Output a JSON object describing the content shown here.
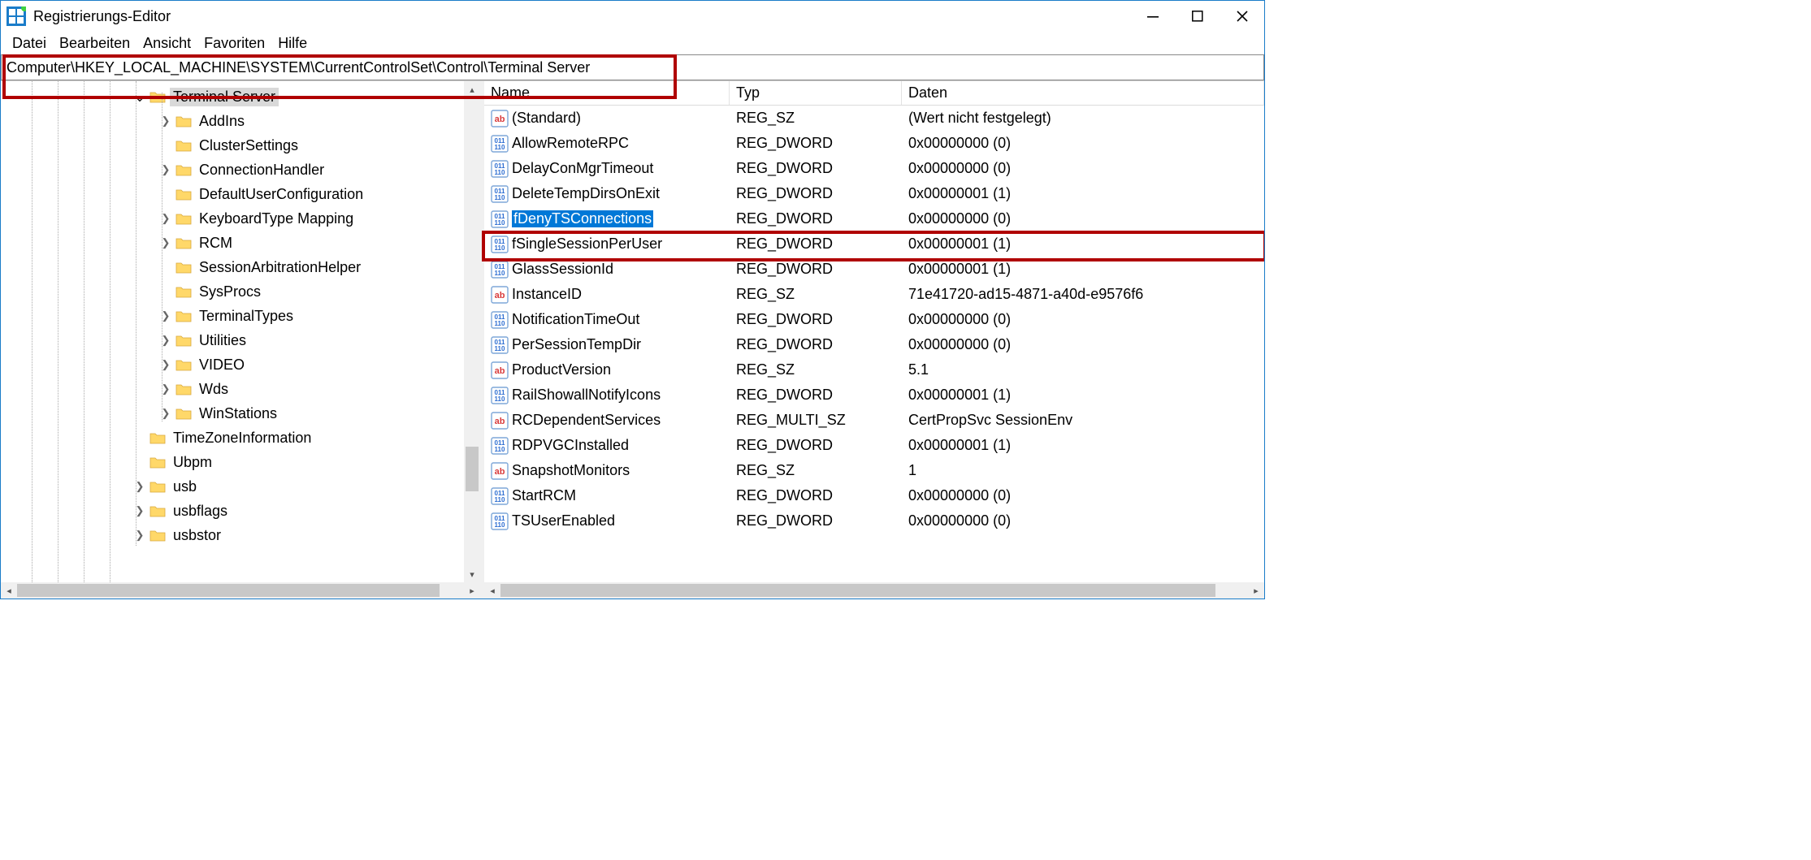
{
  "window": {
    "title": "Registrierungs-Editor"
  },
  "menu": {
    "file": "Datei",
    "edit": "Bearbeiten",
    "view": "Ansicht",
    "favorites": "Favoriten",
    "help": "Hilfe"
  },
  "address": "Computer\\HKEY_LOCAL_MACHINE\\SYSTEM\\CurrentControlSet\\Control\\Terminal Server",
  "tree": [
    {
      "indent": 160,
      "expander": "open",
      "label": "Terminal Server",
      "selected": true
    },
    {
      "indent": 192,
      "expander": "closed",
      "label": "AddIns"
    },
    {
      "indent": 192,
      "expander": "none",
      "label": "ClusterSettings"
    },
    {
      "indent": 192,
      "expander": "closed",
      "label": "ConnectionHandler"
    },
    {
      "indent": 192,
      "expander": "none",
      "label": "DefaultUserConfiguration"
    },
    {
      "indent": 192,
      "expander": "closed",
      "label": "KeyboardType Mapping"
    },
    {
      "indent": 192,
      "expander": "closed",
      "label": "RCM"
    },
    {
      "indent": 192,
      "expander": "none",
      "label": "SessionArbitrationHelper"
    },
    {
      "indent": 192,
      "expander": "none",
      "label": "SysProcs"
    },
    {
      "indent": 192,
      "expander": "closed",
      "label": "TerminalTypes"
    },
    {
      "indent": 192,
      "expander": "closed",
      "label": "Utilities"
    },
    {
      "indent": 192,
      "expander": "closed",
      "label": "VIDEO"
    },
    {
      "indent": 192,
      "expander": "closed",
      "label": "Wds"
    },
    {
      "indent": 192,
      "expander": "closed",
      "label": "WinStations"
    },
    {
      "indent": 160,
      "expander": "none",
      "label": "TimeZoneInformation"
    },
    {
      "indent": 160,
      "expander": "none",
      "label": "Ubpm"
    },
    {
      "indent": 160,
      "expander": "closed",
      "label": "usb"
    },
    {
      "indent": 160,
      "expander": "closed",
      "label": "usbflags"
    },
    {
      "indent": 160,
      "expander": "closed",
      "label": "usbstor"
    }
  ],
  "columns": {
    "name": "Name",
    "type": "Typ",
    "data": "Daten"
  },
  "values": [
    {
      "icon": "sz",
      "name": "(Standard)",
      "type": "REG_SZ",
      "data": "(Wert nicht festgelegt)"
    },
    {
      "icon": "bin",
      "name": "AllowRemoteRPC",
      "type": "REG_DWORD",
      "data": "0x00000000 (0)"
    },
    {
      "icon": "bin",
      "name": "DelayConMgrTimeout",
      "type": "REG_DWORD",
      "data": "0x00000000 (0)"
    },
    {
      "icon": "bin",
      "name": "DeleteTempDirsOnExit",
      "type": "REG_DWORD",
      "data": "0x00000001 (1)"
    },
    {
      "icon": "bin",
      "name": "fDenyTSConnections",
      "type": "REG_DWORD",
      "data": "0x00000000 (0)",
      "selected": true
    },
    {
      "icon": "bin",
      "name": "fSingleSessionPerUser",
      "type": "REG_DWORD",
      "data": "0x00000001 (1)"
    },
    {
      "icon": "bin",
      "name": "GlassSessionId",
      "type": "REG_DWORD",
      "data": "0x00000001 (1)"
    },
    {
      "icon": "sz",
      "name": "InstanceID",
      "type": "REG_SZ",
      "data": "71e41720-ad15-4871-a40d-e9576f6"
    },
    {
      "icon": "bin",
      "name": "NotificationTimeOut",
      "type": "REG_DWORD",
      "data": "0x00000000 (0)"
    },
    {
      "icon": "bin",
      "name": "PerSessionTempDir",
      "type": "REG_DWORD",
      "data": "0x00000000 (0)"
    },
    {
      "icon": "sz",
      "name": "ProductVersion",
      "type": "REG_SZ",
      "data": "5.1"
    },
    {
      "icon": "bin",
      "name": "RailShowallNotifyIcons",
      "type": "REG_DWORD",
      "data": "0x00000001 (1)"
    },
    {
      "icon": "sz",
      "name": "RCDependentServices",
      "type": "REG_MULTI_SZ",
      "data": "CertPropSvc SessionEnv"
    },
    {
      "icon": "bin",
      "name": "RDPVGCInstalled",
      "type": "REG_DWORD",
      "data": "0x00000001 (1)"
    },
    {
      "icon": "sz",
      "name": "SnapshotMonitors",
      "type": "REG_SZ",
      "data": "1"
    },
    {
      "icon": "bin",
      "name": "StartRCM",
      "type": "REG_DWORD",
      "data": "0x00000000 (0)"
    },
    {
      "icon": "bin",
      "name": "TSUserEnabled",
      "type": "REG_DWORD",
      "data": "0x00000000 (0)"
    }
  ]
}
